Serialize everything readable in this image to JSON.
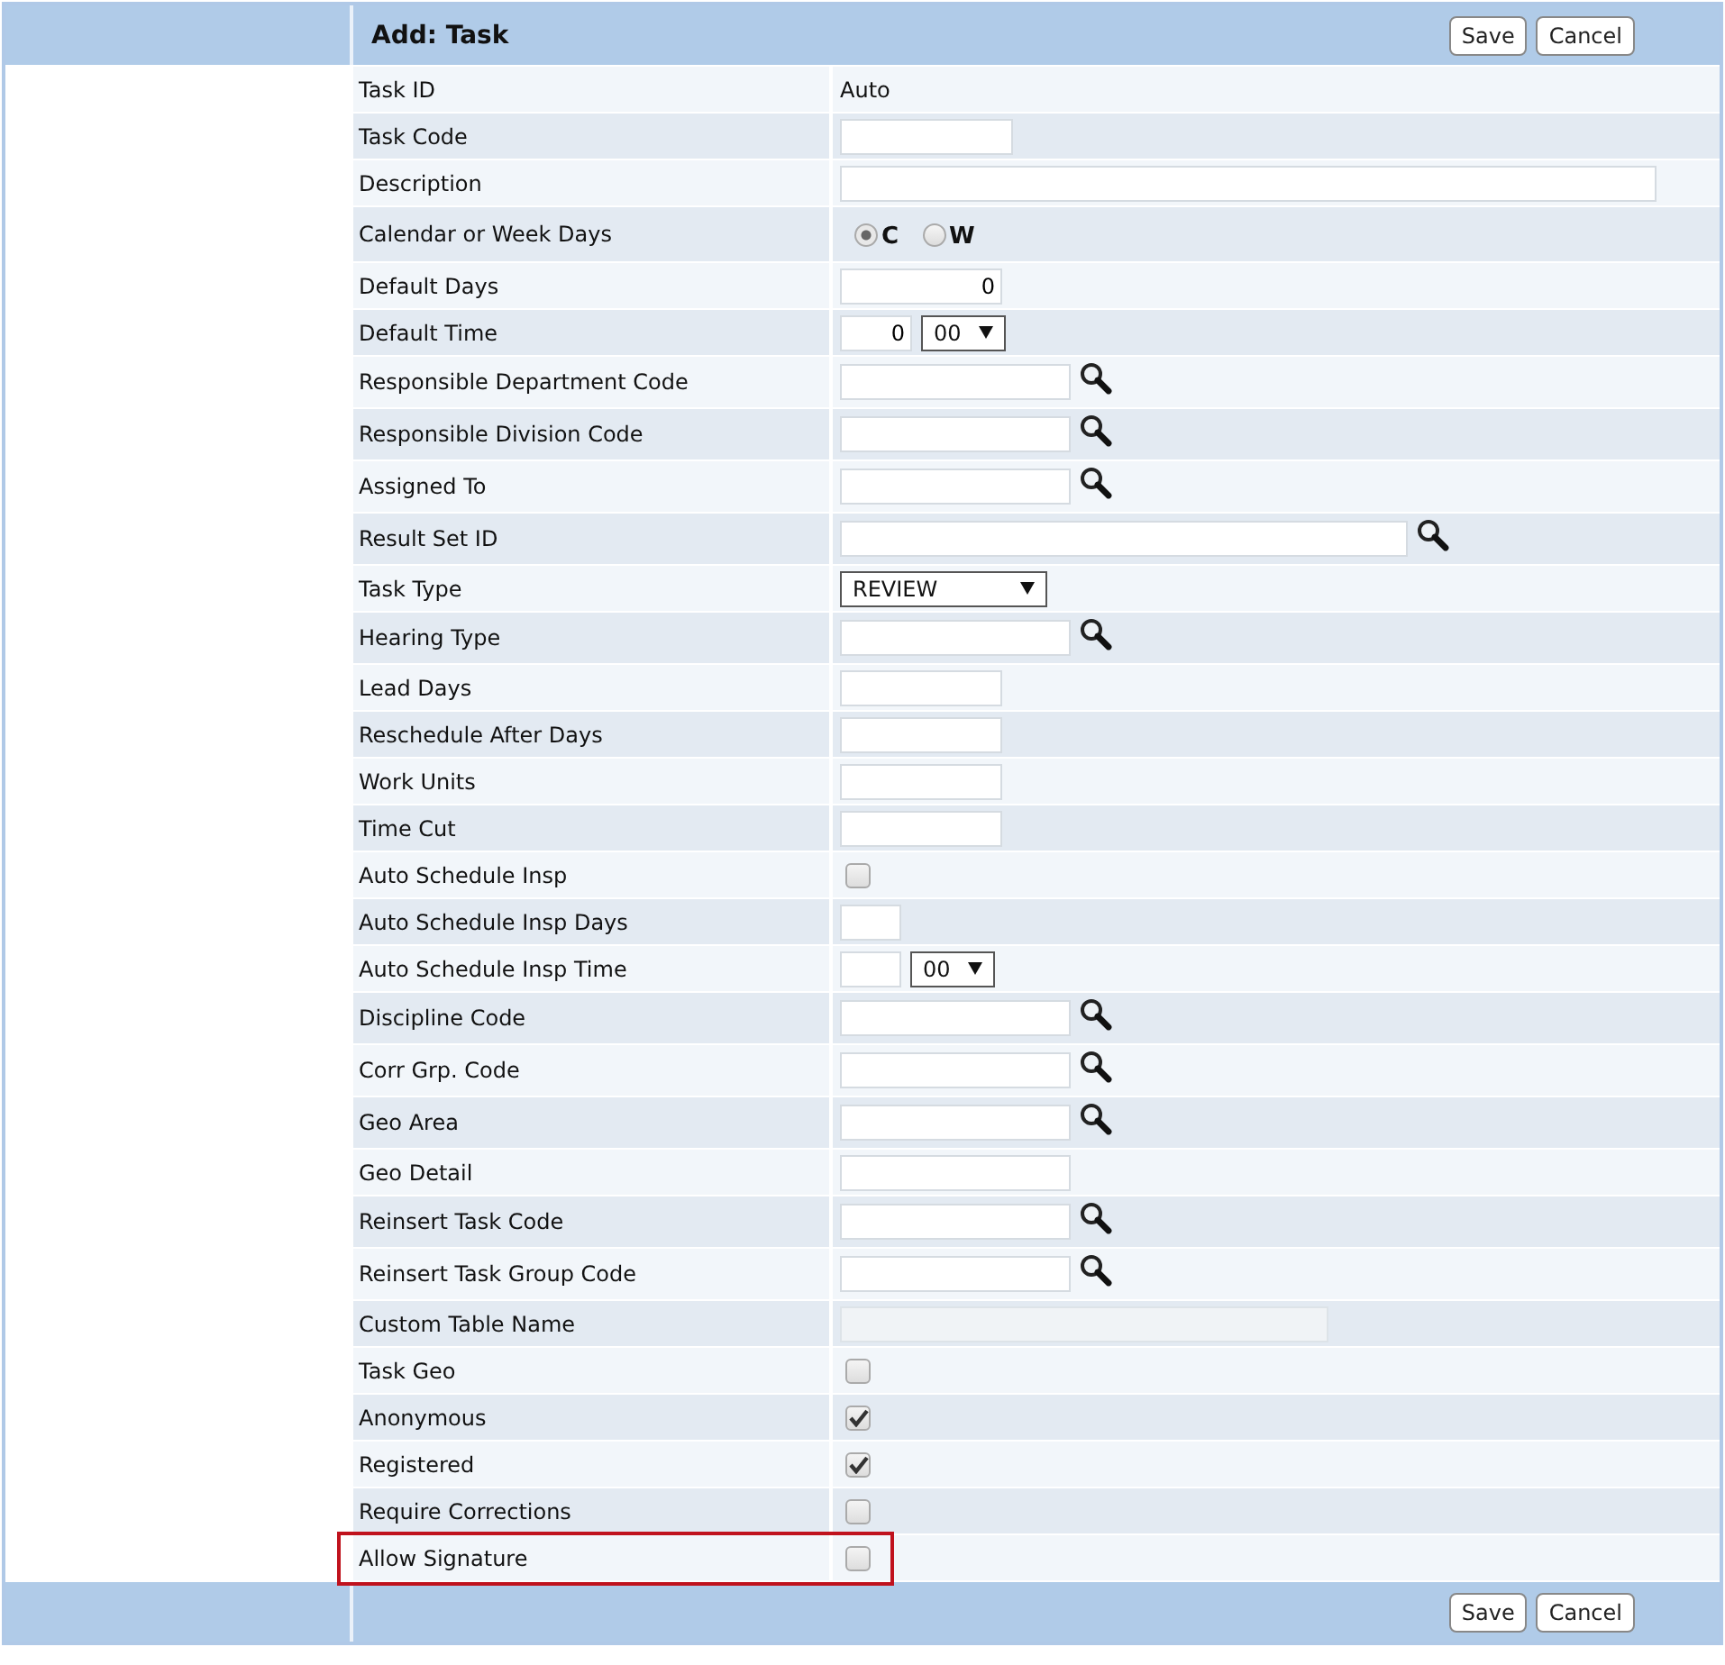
{
  "header": {
    "title": "Add: Task",
    "buttons": [
      "Save",
      "Cancel"
    ]
  },
  "rows": [
    {
      "label": "Task ID",
      "kind": "text",
      "value": "Auto"
    },
    {
      "label": "Task Code",
      "kind": "code"
    },
    {
      "label": "Description",
      "kind": "long"
    },
    {
      "label": "Calendar or Week Days",
      "kind": "radio",
      "options": [
        {
          "label": "C",
          "selected": true
        },
        {
          "label": "W",
          "selected": false
        }
      ]
    },
    {
      "label": "Default Days",
      "kind": "number",
      "value": "0"
    },
    {
      "label": "Default Time",
      "kind": "time",
      "value": "0",
      "select": "00"
    },
    {
      "label": "Responsible Department Code",
      "kind": "lookup"
    },
    {
      "label": "Responsible Division Code",
      "kind": "lookup"
    },
    {
      "label": "Assigned To",
      "kind": "lookup"
    },
    {
      "label": "Result Set ID",
      "kind": "lookup-wide"
    },
    {
      "label": "Task Type",
      "kind": "select",
      "select": "REVIEW"
    },
    {
      "label": "Hearing Type",
      "kind": "lookup"
    },
    {
      "label": "Lead Days",
      "kind": "short"
    },
    {
      "label": "Reschedule After Days",
      "kind": "short"
    },
    {
      "label": "Work Units",
      "kind": "short"
    },
    {
      "label": "Time Cut",
      "kind": "short"
    },
    {
      "label": "Auto Schedule Insp",
      "kind": "checkbox",
      "checked": false
    },
    {
      "label": "Auto Schedule Insp Days",
      "kind": "tiny"
    },
    {
      "label": "Auto Schedule Insp Time",
      "kind": "tiny-time",
      "select": "00"
    },
    {
      "label": "Discipline Code",
      "kind": "lookup"
    },
    {
      "label": "Corr Grp. Code",
      "kind": "lookup"
    },
    {
      "label": "Geo Area",
      "kind": "lookup"
    },
    {
      "label": "Geo Detail",
      "kind": "plain"
    },
    {
      "label": "Reinsert Task Code",
      "kind": "lookup"
    },
    {
      "label": "Reinsert Task Group Code",
      "kind": "lookup"
    },
    {
      "label": "Custom Table Name",
      "kind": "disabled"
    },
    {
      "label": "Task Geo",
      "kind": "checkbox",
      "checked": false
    },
    {
      "label": "Anonymous",
      "kind": "checkbox",
      "checked": true
    },
    {
      "label": "Registered",
      "kind": "checkbox",
      "checked": true
    },
    {
      "label": "Require Corrections",
      "kind": "checkbox",
      "checked": false
    },
    {
      "label": "Allow Signature",
      "kind": "checkbox",
      "checked": false,
      "highlighted": true
    }
  ],
  "footer": {
    "buttons": [
      "Save",
      "Cancel"
    ]
  }
}
